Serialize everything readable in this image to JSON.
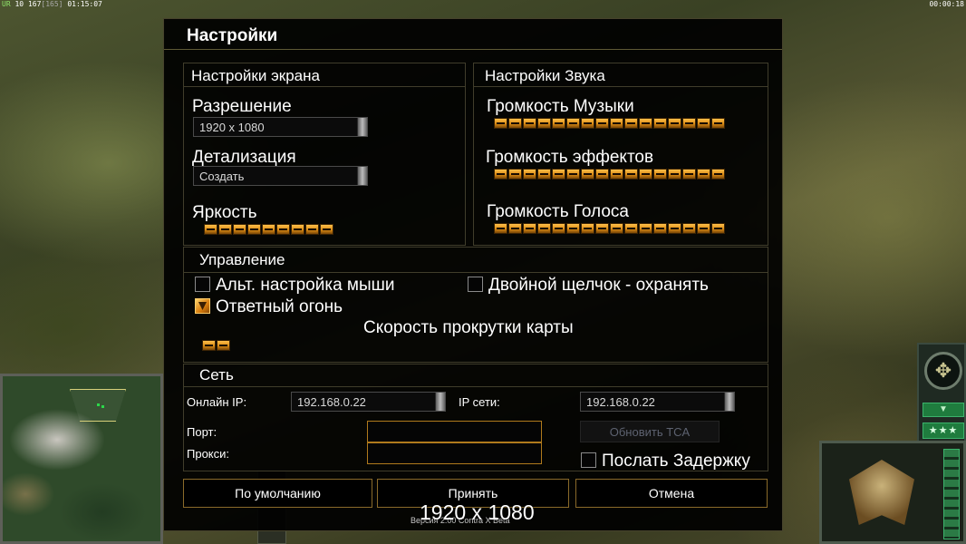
{
  "hud": {
    "ur": "UR",
    "ur_value": "10",
    "count": "167",
    "count_bracket": "[165]",
    "time_left": "01:15:07",
    "time_right": "00:00:18"
  },
  "dialog": {
    "title": "Настройки",
    "screen": {
      "title": "Настройки экрана",
      "resolution_label": "Разрешение",
      "resolution_value": "1920 x 1080",
      "detail_label": "Детализация",
      "detail_value": "Создать",
      "brightness_label": "Яркость",
      "brightness_level": 9
    },
    "sound": {
      "title": "Настройки Звука",
      "music_label": "Громкость Музыки",
      "music_level": 16,
      "effects_label": "Громкость эффектов",
      "effects_level": 16,
      "voice_label": "Громкость Голоса",
      "voice_level": 16
    },
    "controls": {
      "title": "Управление",
      "alt_mouse_label": "Альт. настройка мыши",
      "alt_mouse_checked": false,
      "double_click_label": "Двойной щелчок - охранять",
      "double_click_checked": false,
      "return_fire_label": "Ответный огонь",
      "return_fire_checked": true,
      "scroll_speed_label": "Скорость прокрутки карты",
      "scroll_speed_level": 2
    },
    "network": {
      "title": "Сеть",
      "online_ip_label": "Онлайн IP:",
      "online_ip_value": "192.168.0.22",
      "lan_ip_label": "IP сети:",
      "lan_ip_value": "192.168.0.22",
      "port_label": "Порт:",
      "port_value": "",
      "proxy_label": "Прокси:",
      "proxy_value": "",
      "update_tca_label": "Обновить TCA",
      "send_delay_label": "Послать Задержку",
      "send_delay_checked": false
    },
    "buttons": {
      "default_label": "По умолчанию",
      "accept_label": "Принять",
      "cancel_label": "Отмена"
    },
    "version_text": "Версия 2.00 Contra X Beta",
    "resolution_overlay": "1920 x 1080"
  },
  "side_hud": {
    "radar_icon": "compass-icon",
    "arrow_icon": "chevron-down-icon",
    "stars_icon": "rank-stars-icon",
    "stars_text": "★★★"
  },
  "colors": {
    "dialog_bg": "#000000",
    "slider_orange": "#d98a14",
    "input_border": "#b07a1c",
    "hud_green": "#1f7c3e"
  }
}
